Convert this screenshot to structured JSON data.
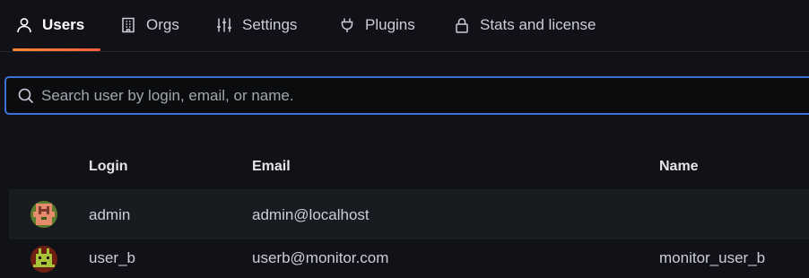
{
  "tabs": [
    {
      "label": "Users",
      "icon": "user-icon",
      "active": true
    },
    {
      "label": "Orgs",
      "icon": "building-icon",
      "active": false
    },
    {
      "label": "Settings",
      "icon": "sliders-icon",
      "active": false
    },
    {
      "label": "Plugins",
      "icon": "plug-icon",
      "active": false
    },
    {
      "label": "Stats and license",
      "icon": "lock-icon",
      "active": false
    }
  ],
  "search": {
    "placeholder": "Search user by login, email, or name.",
    "value": ""
  },
  "table": {
    "columns": [
      "Login",
      "Email",
      "Name"
    ],
    "rows": [
      {
        "login": "admin",
        "email": "admin@localhost",
        "name": ""
      },
      {
        "login": "user_b",
        "email": "userb@monitor.com",
        "name": "monitor_user_b"
      }
    ]
  },
  "colors": {
    "background": "#111217",
    "accent": "#f55f3e",
    "search_border": "#3d71d9",
    "row_alt": "#181b1f"
  }
}
